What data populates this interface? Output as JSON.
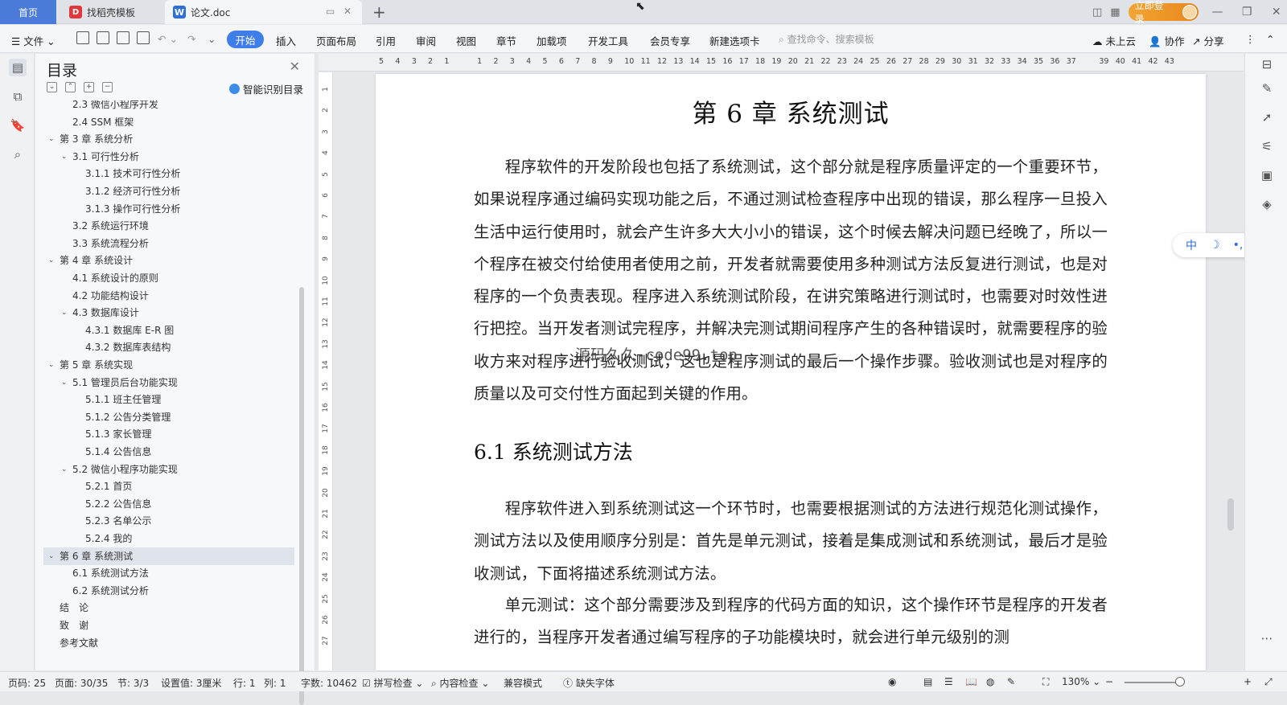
{
  "tabs": {
    "home": "首页",
    "template": "找稻壳模板",
    "doc": "论文.doc",
    "new_tab": "+"
  },
  "topright": {
    "login": "立即登录",
    "minimize": "—",
    "restore": "❐",
    "close": "✕"
  },
  "toolbar": {
    "file_menu": "文件",
    "start": "开始",
    "menus": [
      "插入",
      "页面布局",
      "引用",
      "审阅",
      "视图",
      "章节",
      "加载项",
      "开发工具",
      "会员专享",
      "新建选项卡"
    ],
    "search_placeholder": "查找命令、搜索模板",
    "cloud": "未上云",
    "collab": "协作",
    "share": "分享"
  },
  "nav": {
    "title": "目录",
    "smart": "智能识别目录",
    "items": [
      {
        "text": "2.3 微信小程序开发",
        "level": 2
      },
      {
        "text": "2.4 SSM 框架",
        "level": 2
      },
      {
        "text": "第 3 章 系统分析",
        "level": 1,
        "expand": true
      },
      {
        "text": "3.1 可行性分析",
        "level": 2,
        "expand": true
      },
      {
        "text": "3.1.1 技术可行性分析",
        "level": 3
      },
      {
        "text": "3.1.2 经济可行性分析",
        "level": 3
      },
      {
        "text": "3.1.3 操作可行性分析",
        "level": 3
      },
      {
        "text": "3.2 系统运行环境",
        "level": 2
      },
      {
        "text": "3.3 系统流程分析",
        "level": 2
      },
      {
        "text": "第 4 章 系统设计",
        "level": 1,
        "expand": true
      },
      {
        "text": "4.1 系统设计的原则",
        "level": 2
      },
      {
        "text": "4.2 功能结构设计",
        "level": 2
      },
      {
        "text": "4.3 数据库设计",
        "level": 2,
        "expand": true
      },
      {
        "text": "4.3.1 数据库 E-R 图",
        "level": 3
      },
      {
        "text": "4.3.2 数据库表结构",
        "level": 3
      },
      {
        "text": "第 5 章 系统实现",
        "level": 1,
        "expand": true
      },
      {
        "text": "5.1 管理员后台功能实现",
        "level": 2,
        "expand": true
      },
      {
        "text": "5.1.1 班主任管理",
        "level": 3
      },
      {
        "text": "5.1.2 公告分类管理",
        "level": 3
      },
      {
        "text": "5.1.3 家长管理",
        "level": 3
      },
      {
        "text": "5.1.4 公告信息",
        "level": 3
      },
      {
        "text": "5.2 微信小程序功能实现",
        "level": 2,
        "expand": true
      },
      {
        "text": "5.2.1 首页",
        "level": 3
      },
      {
        "text": "5.2.2 公告信息",
        "level": 3
      },
      {
        "text": "5.2.3 名单公示",
        "level": 3
      },
      {
        "text": "5.2.4 我的",
        "level": 3
      },
      {
        "text": "第 6 章 系统测试",
        "level": 1,
        "expand": true,
        "selected": true
      },
      {
        "text": "6.1 系统测试方法",
        "level": 2
      },
      {
        "text": "6.2 系统测试分析",
        "level": 2
      },
      {
        "text": "结　论",
        "level": 1
      },
      {
        "text": "致　谢",
        "level": 1
      },
      {
        "text": "参考文献",
        "level": 1
      }
    ]
  },
  "ruler": {
    "h": [
      "5",
      "4",
      "3",
      "2",
      "1",
      "",
      "1",
      "2",
      "3",
      "4",
      "5",
      "6",
      "7",
      "8",
      "9",
      "10",
      "11",
      "12",
      "13",
      "14",
      "15",
      "16",
      "17",
      "18",
      "19",
      "20",
      "21",
      "22",
      "23",
      "24",
      "25",
      "26",
      "27",
      "28",
      "29",
      "30",
      "31",
      "32",
      "33",
      "34",
      "35",
      "36",
      "37",
      "",
      "39",
      "40",
      "41",
      "42",
      "43"
    ],
    "v": [
      "1",
      "2",
      "3",
      "4",
      "5",
      "6",
      "7",
      "8",
      "9",
      "10",
      "11",
      "12",
      "13",
      "14",
      "15",
      "16",
      "17",
      "18",
      "19",
      "20",
      "21",
      "22",
      "23",
      "24",
      "25",
      "26",
      "27"
    ]
  },
  "doc": {
    "chapter_title": "第 6 章  系统测试",
    "p1": "程序软件的开发阶段也包括了系统测试，这个部分就是程序质量评定的一个重要环节，如果说程序通过编码实现功能之后，不通过测试检查程序中出现的错误，那么程序一旦投入生活中运行使用时，就会产生许多大大小小的错误，这个时候去解决问题已经晚了，所以一个程序在被交付给使用者使用之前，开发者就需要使用多种测试方法反复进行测试，也是对程序的一个负责表现。程序进入系统测试阶段，在讲究策略进行测试时，也需要对时效性进行把控。当开发者测试完程序，并解决完测试期间程序产生的各种错误时，就需要程序的验收方来对程序进行验收测试，这也是程序测试的最后一个操作步骤。验收测试也是对程序的质量以及可交付性方面起到关键的作用。",
    "section_title": "6.1 系统测试方法",
    "p2": "程序软件进入到系统测试这一个环节时，也需要根据测试的方法进行规范化测试操作，测试方法以及使用顺序分别是：首先是单元测试，接着是集成测试和系统测试，最后才是验收测试，下面将描述系统测试方法。",
    "p3": "单元测试：这个部分需要涉及到程序的代码方面的知识，这个操作环节是程序的开发者进行的，当程序开发者通过编写程序的子功能模块时，就会进行单元级别的测",
    "watermark": "源码久久-code99.top"
  },
  "ime": {
    "lang": "中",
    "moon": "☽",
    "punct": "•,",
    "arrow": "›"
  },
  "status": {
    "wordcount_page": "页码: 25",
    "page": "页面: 30/35",
    "section": "节: 3/3",
    "setting": "设置值: 3厘米",
    "row": "行: 1",
    "col": "列: 1",
    "chars": "字数: 10462",
    "spell": "拼写检查",
    "content": "内容检查",
    "compat": "兼容模式",
    "missing_font": "缺失字体",
    "zoom": "130%"
  }
}
